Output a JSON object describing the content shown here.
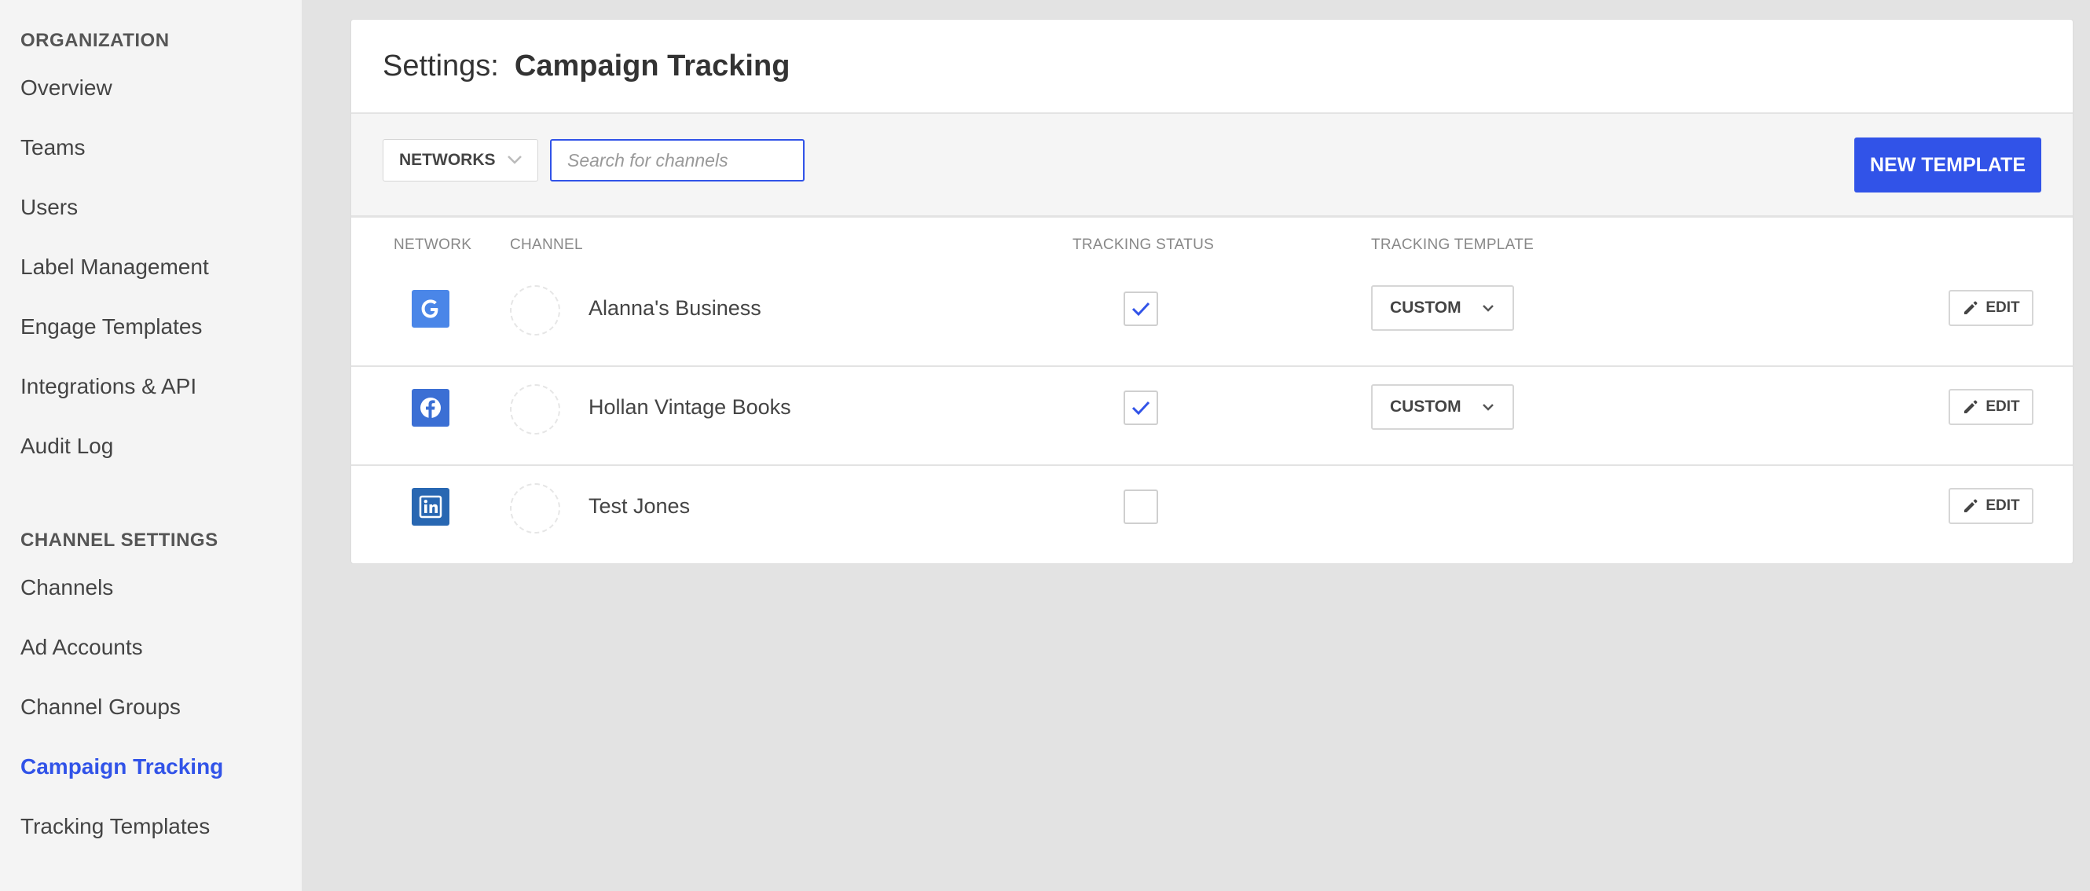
{
  "sidebar": {
    "sections": [
      {
        "title": "ORGANIZATION",
        "items": [
          "Overview",
          "Teams",
          "Users",
          "Label Management",
          "Engage Templates",
          "Integrations & API",
          "Audit Log"
        ]
      },
      {
        "title": "CHANNEL SETTINGS",
        "items": [
          "Channels",
          "Ad Accounts",
          "Channel Groups",
          "Campaign Tracking",
          "Tracking Templates"
        ]
      }
    ],
    "active_item": "Campaign Tracking"
  },
  "header": {
    "prefix": "Settings:",
    "title": "Campaign Tracking"
  },
  "toolbar": {
    "networks_label": "NETWORKS",
    "search_placeholder": "Search for channels",
    "search_value": "",
    "new_template_label": "NEW TEMPLATE"
  },
  "table": {
    "columns": {
      "network": "NETWORK",
      "channel": "CHANNEL",
      "tracking_status": "TRACKING STATUS",
      "tracking_template": "TRACKING TEMPLATE"
    },
    "edit_label": "EDIT",
    "rows": [
      {
        "network": "google-icon",
        "channel": "Alanna's Business",
        "tracking_enabled": true,
        "template": "CUSTOM"
      },
      {
        "network": "facebook-icon",
        "channel": "Hollan Vintage Books",
        "tracking_enabled": true,
        "template": "CUSTOM"
      },
      {
        "network": "linkedin-icon",
        "channel": "Test Jones",
        "tracking_enabled": false,
        "template": ""
      }
    ]
  },
  "colors": {
    "accent": "#3153e8",
    "google": "#4a86e8",
    "facebook": "#3b6fd4",
    "linkedin": "#2867b2"
  }
}
